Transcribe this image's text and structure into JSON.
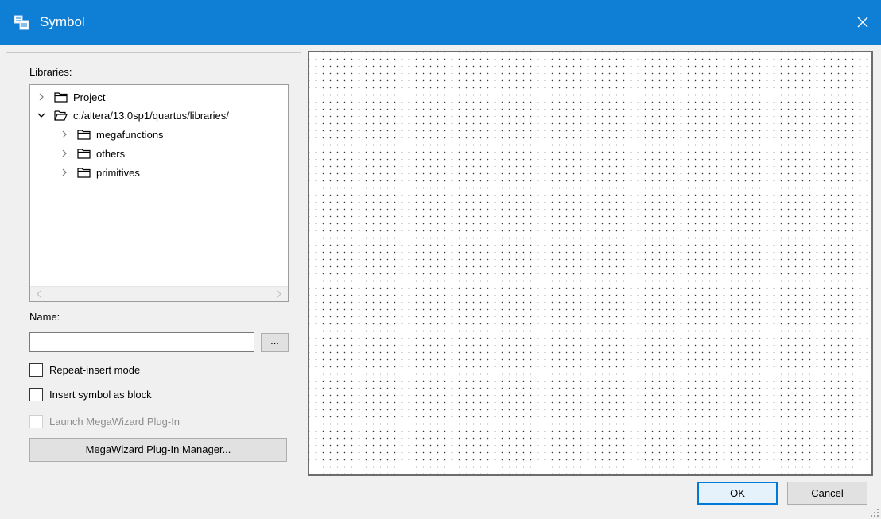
{
  "window": {
    "title": "Symbol",
    "icon": "symbol-app-icon",
    "close_icon": "close-icon"
  },
  "libraries": {
    "label": "Libraries:",
    "tree": [
      {
        "label": "Project",
        "expanded": false,
        "level": 0,
        "icon": "folder-closed-icon"
      },
      {
        "label": "c:/altera/13.0sp1/quartus/libraries/",
        "expanded": true,
        "level": 0,
        "icon": "folder-open-icon"
      },
      {
        "label": "megafunctions",
        "expanded": false,
        "level": 1,
        "icon": "folder-closed-icon"
      },
      {
        "label": "others",
        "expanded": false,
        "level": 1,
        "icon": "folder-closed-icon"
      },
      {
        "label": "primitives",
        "expanded": false,
        "level": 1,
        "icon": "folder-closed-icon"
      }
    ]
  },
  "name": {
    "label": "Name:",
    "value": "",
    "browse_label": "..."
  },
  "options": {
    "repeat_insert": {
      "label": "Repeat-insert mode",
      "checked": false,
      "enabled": true
    },
    "insert_as_block": {
      "label": "Insert symbol as block",
      "checked": false,
      "enabled": true
    },
    "launch_megawizard": {
      "label": "Launch MegaWizard Plug-In",
      "checked": false,
      "enabled": false
    }
  },
  "megawizard_button": "MegaWizard Plug-In Manager...",
  "buttons": {
    "ok": "OK",
    "cancel": "Cancel"
  },
  "colors": {
    "titlebar": "#0f7fd6",
    "focus_border": "#0078d7"
  }
}
